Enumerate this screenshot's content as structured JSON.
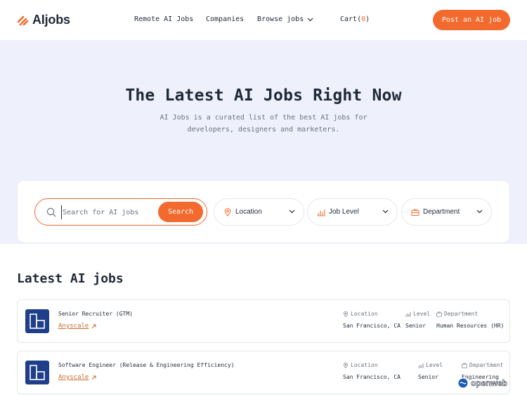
{
  "header": {
    "brand": "AIjobs",
    "nav": {
      "remote": "Remote AI Jobs",
      "companies": "Companies",
      "browse": "Browse jobs",
      "cart_label": "Cart(",
      "cart_count": "0",
      "cart_close": ")"
    },
    "post_button": "Post an AI job"
  },
  "hero": {
    "title": "The Latest AI Jobs Right Now",
    "subtitle_line1": "AI Jobs is a curated list of the best AI jobs for",
    "subtitle_line2": "developers, designers and marketers."
  },
  "search": {
    "placeholder": "Search for AI jobs",
    "value": "",
    "button": "Search",
    "location": "Location",
    "level": "Job Level",
    "department": "Department"
  },
  "section": {
    "title": "Latest AI jobs"
  },
  "meta_labels": {
    "location": "Location",
    "level": "Level",
    "department": "Department"
  },
  "jobs": [
    {
      "title": "Senior Recruiter (GTM)",
      "company": "Anyscale",
      "location": "San Francisco, CA",
      "level": "Senior",
      "department": "Human Resources (HR)"
    },
    {
      "title": "Software Engineer (Release & Engineering Efficiency)",
      "company": "Anyscale",
      "location": "San Francisco, CA",
      "level": "Senior",
      "department": "Engineering"
    }
  ],
  "watermark": "openweb",
  "colors": {
    "accent": "#f26a2e",
    "hero_bg": "#eef1fb",
    "company_logo_bg": "#1f3f8a",
    "company_link": "#c8692d"
  }
}
